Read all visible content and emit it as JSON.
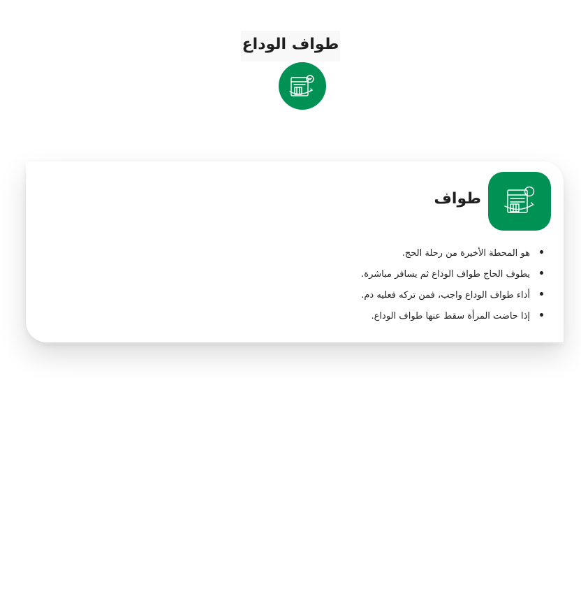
{
  "header": {
    "title": "طواف الوداع",
    "icon": "calendar-cycle-icon"
  },
  "card": {
    "title": "طواف",
    "icon": "calendar-cycle-icon",
    "points": [
      "هو المحطة الأخيرة من رحلة الحج.",
      "يطوف الحاج طواف الوداع ثم يسافر مباشرة.",
      "أداء طواف الوداع واجب، فمن تركه فعليه دم.",
      "إذا حاضت المرأة سقط عنها طواف الوداع."
    ]
  },
  "colors": {
    "accent": "#009154",
    "text": "#1f1f1f",
    "background": "#ffffff"
  }
}
